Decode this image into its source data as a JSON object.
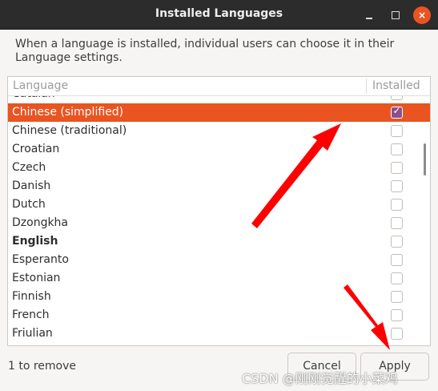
{
  "window": {
    "title": "Installed Languages",
    "close_glyph": "×"
  },
  "description": "When a language is installed, individual users can choose it in their Language settings.",
  "list": {
    "col_language": "Language",
    "col_installed": "Installed",
    "items": [
      {
        "label": "Catalan",
        "installed": false,
        "selected": false,
        "bold": false
      },
      {
        "label": "Chinese (simplified)",
        "installed": true,
        "selected": true,
        "bold": false
      },
      {
        "label": "Chinese (traditional)",
        "installed": false,
        "selected": false,
        "bold": false
      },
      {
        "label": "Croatian",
        "installed": false,
        "selected": false,
        "bold": false
      },
      {
        "label": "Czech",
        "installed": false,
        "selected": false,
        "bold": false
      },
      {
        "label": "Danish",
        "installed": false,
        "selected": false,
        "bold": false
      },
      {
        "label": "Dutch",
        "installed": false,
        "selected": false,
        "bold": false
      },
      {
        "label": "Dzongkha",
        "installed": false,
        "selected": false,
        "bold": false
      },
      {
        "label": "English",
        "installed": false,
        "selected": false,
        "bold": true
      },
      {
        "label": "Esperanto",
        "installed": false,
        "selected": false,
        "bold": false
      },
      {
        "label": "Estonian",
        "installed": false,
        "selected": false,
        "bold": false
      },
      {
        "label": "Finnish",
        "installed": false,
        "selected": false,
        "bold": false
      },
      {
        "label": "French",
        "installed": false,
        "selected": false,
        "bold": false
      },
      {
        "label": "Friulian",
        "installed": false,
        "selected": false,
        "bold": false
      }
    ]
  },
  "footer": {
    "status": "1 to remove",
    "cancel_label": "Cancel",
    "apply_label": "Apply"
  },
  "watermark": "CSDN @刚刚觉醒的小菜鸡",
  "colors": {
    "accent": "#e95420",
    "checkbox_checked": "#924d8b",
    "annotation_arrow": "#ff0000"
  }
}
